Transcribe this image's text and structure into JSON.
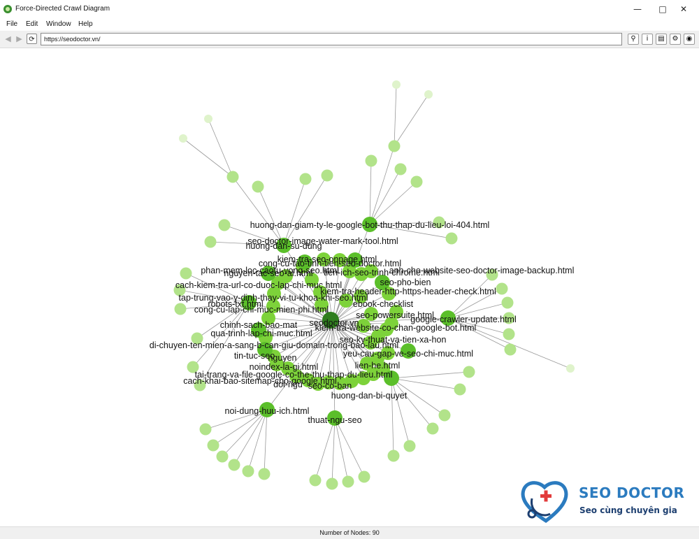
{
  "window": {
    "title": "Force-Directed Crawl Diagram",
    "minimize_icon": "minimize-icon",
    "maximize_icon": "maximize-icon",
    "close_icon": "close-icon"
  },
  "menu": [
    "File",
    "Edit",
    "Window",
    "Help"
  ],
  "toolbar": {
    "url": "https://seodoctor.vn/",
    "buttons": [
      "search-icon",
      "info-icon",
      "save-icon",
      "settings-icon",
      "globe-icon"
    ]
  },
  "status": {
    "nodes_text": "Number of Nodes: 90"
  },
  "colors": {
    "root": "#2f7d1e",
    "hub": "#5bbf2a",
    "node": "#7dd23a",
    "leaf": "#b2e38a",
    "faint": "#dff3cb",
    "edge": "#999999"
  },
  "logo": {
    "name": "SEO DOCTOR",
    "tagline": "Seo cùng chuyên gia"
  },
  "graph": {
    "labels": [
      "huong-dan-giam-ty-le-google-bot-thu-thap-du-lieu-loi-404.html",
      "seo-doctor-image-water-mark-tool.html",
      "huong-dan-su-dung",
      "kiem-tra-seo-onpage.html",
      "cong-cu-tao-tinh-tien-seo-doctor.html",
      "phan-mem-loc-caotu-vong-seo.html",
      "nguyen-tac-seo-ai.html",
      "tien-ich-seo-trinh-chrome.html",
      "anh-cho-website-seo-doctor-image-backup.html",
      "cach-kiem-tra-url-co-duoc-lap-chi-muc.html",
      "seo-pho-bien",
      "kiem-tra-header-http-https-header-check.html",
      "tap-trung-vao-y-dinh-thay-vi-tu-khoa-khi-seo.html",
      "robots-txt.html",
      "ebook-checklist",
      "cong-cu-lap-chi-muc-mien-phi.html",
      "seo-powersuite.html",
      "google-crawler-update.html",
      "chinh-sach-bao-mat",
      "seodoctor.vn",
      "kiem-tra-website-co-chan-google-bot.html",
      "qua-trinh-lap-chi-muc.html",
      "seo-ky-thuat-va-tien-xa-hon",
      "di-chuyen-ten-mien-a-sang-b-can-giu-domain-trong-bao-lau.html",
      "yeu-cau-gap-ve-seo-chi-muc.html",
      "tin-tuc-seo",
      "nguyen",
      "lien-he.html",
      "noindex-la-gi.html",
      "tai-trang-va-file-google-co-the-thu-thap-du-lieu.html",
      "cach-khai-bao-sitemap-cho-google.html",
      "doi-ngu",
      "seo-co-ban",
      "huong-dan-bi-quyet",
      "noi-dung-huu-ich.html",
      "thuat-ngu-seo"
    ]
  }
}
